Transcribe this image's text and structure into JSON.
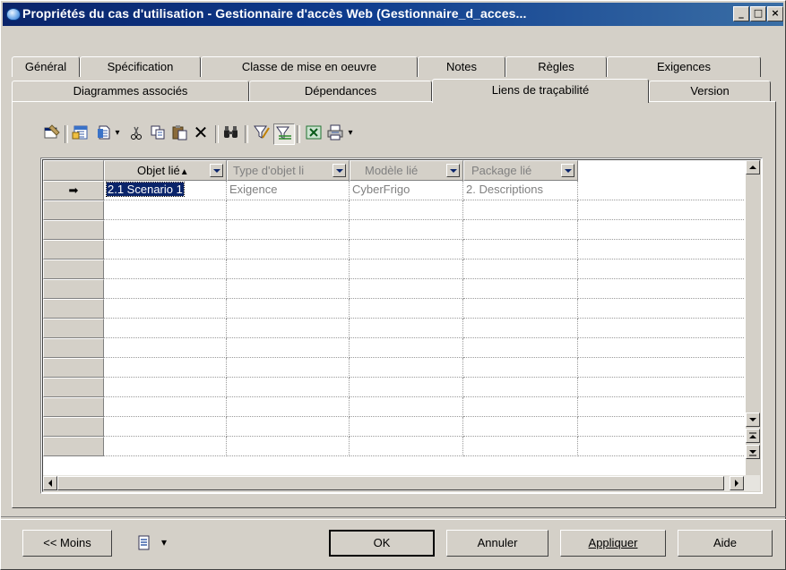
{
  "window": {
    "title": "Propriétés du cas d'utilisation - Gestionnaire d'accès Web (Gestionnaire_d_acces...",
    "buttons": {
      "minimize": "_",
      "maximize": "□",
      "close": "×"
    }
  },
  "tabs": {
    "row1": [
      "Général",
      "Spécification",
      "Classe de mise en oeuvre",
      "Notes",
      "Règles",
      "Exigences"
    ],
    "row2": [
      "Diagrammes associés",
      "Dépendances",
      "Liens de traçabilité",
      "Version"
    ],
    "active": "Liens de traçabilité"
  },
  "toolbar": {
    "icons": [
      "properties-icon",
      "add-objects-icon",
      "new-link-icon",
      "dropdown-icon",
      "cut-icon",
      "copy-icon",
      "paste-icon",
      "delete-icon",
      "find-icon",
      "filter-icon",
      "customize-columns-icon",
      "excel-icon",
      "print-icon",
      "dropdown-icon"
    ]
  },
  "grid": {
    "columns": [
      "Objet lié",
      "Type d'objet li",
      "Modèle lié",
      "Package lié"
    ],
    "sort_indicator": "▲",
    "rows": [
      {
        "marker": "➡",
        "cells": [
          "2.1 Scenario 1",
          "Exigence",
          "CyberFrigo",
          "2. Descriptions"
        ]
      }
    ]
  },
  "footer": {
    "less_button": "<< Moins",
    "ok": "OK",
    "cancel": "Annuler",
    "apply": "Appliquer",
    "help": "Aide"
  },
  "colors": {
    "titlebar": "#0a246a",
    "face": "#d4d0c8",
    "selection": "#0a246a"
  }
}
